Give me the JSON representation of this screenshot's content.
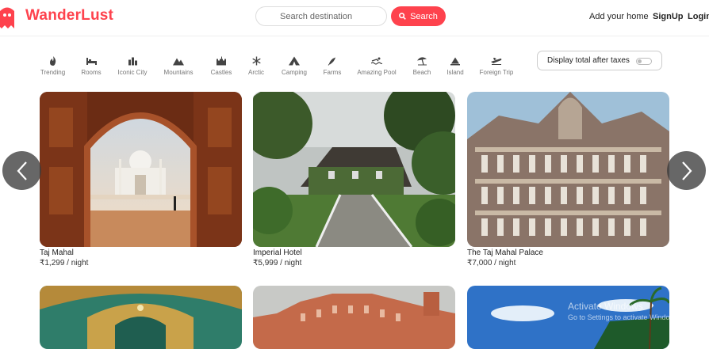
{
  "brand": {
    "name": "WanderLust",
    "color": "#fe424d",
    "icon": "airbnb-style-logo-icon"
  },
  "search": {
    "placeholder": "Search destination",
    "button_label": "Search",
    "icon": "search-icon"
  },
  "nav_links": {
    "add_home": "Add your home",
    "signup": "SignUp",
    "login": "Login"
  },
  "filters": [
    {
      "label": "Trending",
      "icon": "flame-icon"
    },
    {
      "label": "Rooms",
      "icon": "bed-icon"
    },
    {
      "label": "Iconic City",
      "icon": "city-icon"
    },
    {
      "label": "Mountains",
      "icon": "mountain-icon"
    },
    {
      "label": "Castles",
      "icon": "castle-icon"
    },
    {
      "label": "Arctic",
      "icon": "snowflake-icon"
    },
    {
      "label": "Camping",
      "icon": "campground-icon"
    },
    {
      "label": "Farms",
      "icon": "tractor-icon"
    },
    {
      "label": "Amazing Pool",
      "icon": "swimmer-icon"
    },
    {
      "label": "Beach",
      "icon": "umbrella-beach-icon"
    },
    {
      "label": "Island",
      "icon": "island-icon"
    },
    {
      "label": "Foreign Trip",
      "icon": "plane-icon"
    }
  ],
  "tax_toggle": {
    "label": "Display total after taxes",
    "enabled": false
  },
  "listings": [
    {
      "title": "Taj Mahal",
      "price": "₹1,299 / night"
    },
    {
      "title": "Imperial Hotel",
      "price": "₹5,999 / night"
    },
    {
      "title": "The Taj Mahal Palace",
      "price": "₹7,000 / night"
    }
  ],
  "carousel": {
    "prev_icon": "chevron-left-icon",
    "next_icon": "chevron-right-icon"
  },
  "watermark": {
    "line1": "Activate Windows",
    "line2": "Go to Settings to activate Windows."
  }
}
